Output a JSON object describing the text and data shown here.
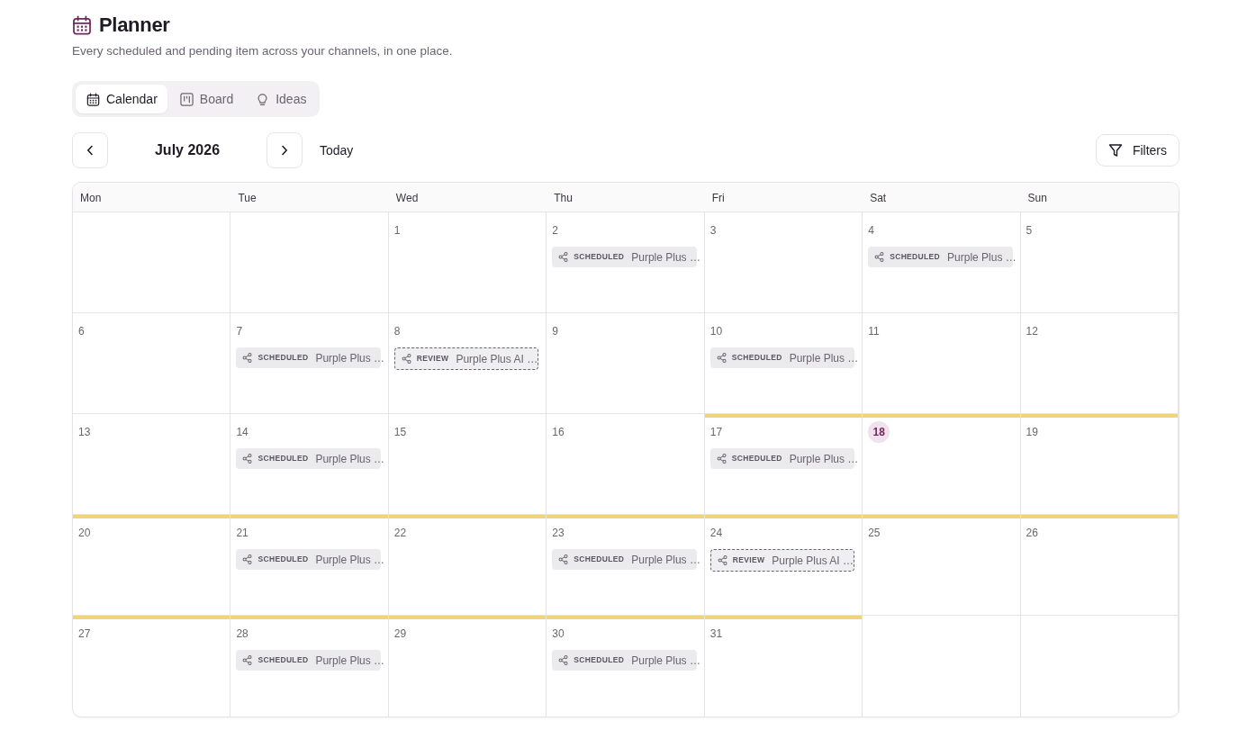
{
  "header": {
    "title": "Planner",
    "subtitle": "Every scheduled and pending item across your channels, in one place."
  },
  "view_tabs": [
    {
      "label": "Calendar",
      "selected": true
    },
    {
      "label": "Board",
      "selected": false
    },
    {
      "label": "Ideas",
      "selected": false
    }
  ],
  "toolbar": {
    "month": "July 2026",
    "today_button": "Today",
    "filters_button": "Filters"
  },
  "calendar": {
    "weekdays": [
      "Mon",
      "Tue",
      "Wed",
      "Thu",
      "Fri",
      "Sat",
      "Sun"
    ],
    "weeks": [
      [
        {
          "kind": "blank"
        },
        {
          "kind": "blank"
        },
        {
          "kind": "day",
          "day": "1",
          "today": false,
          "highlighted": false
        },
        {
          "kind": "day",
          "day": "2",
          "today": false,
          "highlighted": false,
          "events": [
            {
              "kind": "scheduled",
              "status": "SCHEDULED",
              "title": "Purple Plus …"
            }
          ]
        },
        {
          "kind": "day",
          "day": "3",
          "today": false,
          "highlighted": false
        },
        {
          "kind": "day",
          "day": "4",
          "today": false,
          "highlighted": false,
          "events": [
            {
              "kind": "scheduled",
              "status": "SCHEDULED",
              "title": "Purple Plus …"
            }
          ]
        },
        {
          "kind": "day",
          "day": "5",
          "today": false,
          "highlighted": false
        }
      ],
      [
        {
          "kind": "day",
          "day": "6",
          "today": false,
          "highlighted": false
        },
        {
          "kind": "day",
          "day": "7",
          "today": false,
          "highlighted": false,
          "events": [
            {
              "kind": "scheduled",
              "status": "SCHEDULED",
              "title": "Purple Plus …"
            }
          ]
        },
        {
          "kind": "day",
          "day": "8",
          "today": false,
          "highlighted": false,
          "events": [
            {
              "kind": "review",
              "status": "REVIEW",
              "title": "Purple Plus AI …"
            }
          ]
        },
        {
          "kind": "day",
          "day": "9",
          "today": false,
          "highlighted": false
        },
        {
          "kind": "day",
          "day": "10",
          "today": false,
          "highlighted": false,
          "events": [
            {
              "kind": "scheduled",
              "status": "SCHEDULED",
              "title": "Purple Plus …"
            }
          ]
        },
        {
          "kind": "day",
          "day": "11",
          "today": false,
          "highlighted": false
        },
        {
          "kind": "day",
          "day": "12",
          "today": false,
          "highlighted": false
        }
      ],
      [
        {
          "kind": "day",
          "day": "13",
          "today": false,
          "highlighted": false
        },
        {
          "kind": "day",
          "day": "14",
          "today": false,
          "highlighted": false,
          "events": [
            {
              "kind": "scheduled",
              "status": "SCHEDULED",
              "title": "Purple Plus …"
            }
          ]
        },
        {
          "kind": "day",
          "day": "15",
          "today": false,
          "highlighted": false
        },
        {
          "kind": "day",
          "day": "16",
          "today": false,
          "highlighted": false
        },
        {
          "kind": "day",
          "day": "17",
          "today": false,
          "highlighted": true,
          "events": [
            {
              "kind": "scheduled",
              "status": "SCHEDULED",
              "title": "Purple Plus …"
            }
          ]
        },
        {
          "kind": "day",
          "day": "18",
          "today": true,
          "highlighted": true
        },
        {
          "kind": "day",
          "day": "19",
          "today": false,
          "highlighted": true
        }
      ],
      [
        {
          "kind": "day",
          "day": "20",
          "today": false,
          "highlighted": true
        },
        {
          "kind": "day",
          "day": "21",
          "today": false,
          "highlighted": true,
          "events": [
            {
              "kind": "scheduled",
              "status": "SCHEDULED",
              "title": "Purple Plus …"
            }
          ]
        },
        {
          "kind": "day",
          "day": "22",
          "today": false,
          "highlighted": true
        },
        {
          "kind": "day",
          "day": "23",
          "today": false,
          "highlighted": true,
          "events": [
            {
              "kind": "scheduled",
              "status": "SCHEDULED",
              "title": "Purple Plus …"
            }
          ]
        },
        {
          "kind": "day",
          "day": "24",
          "today": false,
          "highlighted": true,
          "events": [
            {
              "kind": "review",
              "status": "REVIEW",
              "title": "Purple Plus AI …"
            }
          ]
        },
        {
          "kind": "day",
          "day": "25",
          "today": false,
          "highlighted": true
        },
        {
          "kind": "day",
          "day": "26",
          "today": false,
          "highlighted": true
        }
      ],
      [
        {
          "kind": "day",
          "day": "27",
          "today": false,
          "highlighted": true
        },
        {
          "kind": "day",
          "day": "28",
          "today": false,
          "highlighted": true,
          "events": [
            {
              "kind": "scheduled",
              "status": "SCHEDULED",
              "title": "Purple Plus …"
            }
          ]
        },
        {
          "kind": "day",
          "day": "29",
          "today": false,
          "highlighted": true
        },
        {
          "kind": "day",
          "day": "30",
          "today": false,
          "highlighted": true,
          "events": [
            {
              "kind": "scheduled",
              "status": "SCHEDULED",
              "title": "Purple Plus …"
            }
          ]
        },
        {
          "kind": "day",
          "day": "31",
          "today": false,
          "highlighted": true
        },
        {
          "kind": "blank"
        },
        {
          "kind": "blank"
        }
      ]
    ]
  }
}
